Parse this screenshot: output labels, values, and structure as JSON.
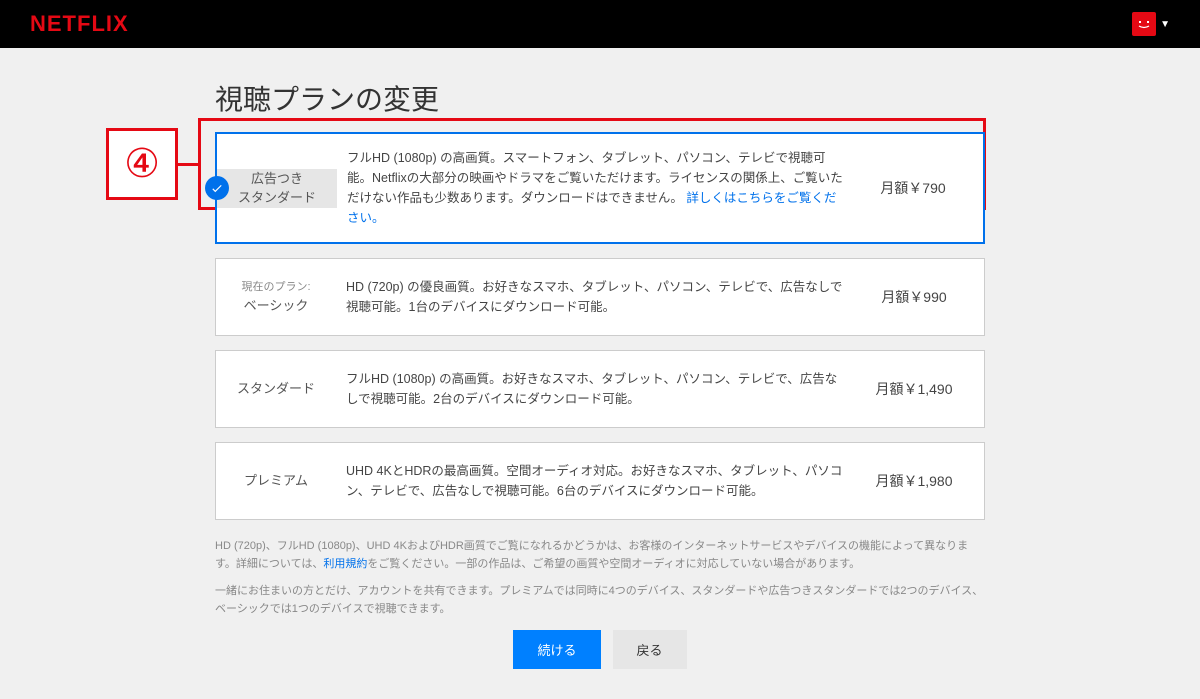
{
  "brand": "NETFLIX",
  "title": "視聴プランの変更",
  "annotation_num": "④",
  "plans": [
    {
      "name": "広告つき\nスタンダード",
      "tag": "",
      "desc_before_link": "フルHD (1080p) の高画質。スマートフォン、タブレット、パソコン、テレビで視聴可能。Netflixの大部分の映画やドラマをご覧いただけます。ライセンスの関係上、ご覧いただけない作品も少数あります。ダウンロードはできません。",
      "link": "詳しくはこちらをご覧ください。",
      "price": "月額￥790",
      "selected": true
    },
    {
      "name": "ベーシック",
      "tag": "現在のプラン:",
      "desc_before_link": "HD (720p) の優良画質。お好きなスマホ、タブレット、パソコン、テレビで、広告なしで視聴可能。1台のデバイスにダウンロード可能。",
      "link": "",
      "price": "月額￥990",
      "selected": false
    },
    {
      "name": "スタンダード",
      "tag": "",
      "desc_before_link": "フルHD (1080p) の高画質。お好きなスマホ、タブレット、パソコン、テレビで、広告なしで視聴可能。2台のデバイスにダウンロード可能。",
      "link": "",
      "price": "月額￥1,490",
      "selected": false
    },
    {
      "name": "プレミアム",
      "tag": "",
      "desc_before_link": "UHD 4KとHDRの最高画質。空間オーディオ対応。お好きなスマホ、タブレット、パソコン、テレビで、広告なしで視聴可能。6台のデバイスにダウンロード可能。",
      "link": "",
      "price": "月額￥1,980",
      "selected": false
    }
  ],
  "fineprint": {
    "p1_before": "HD (720p)、フルHD (1080p)、UHD 4KおよびHDR画質でご覧になれるかどうかは、お客様のインターネットサービスやデバイスの機能によって異なります。詳細については、",
    "p1_link": "利用規約",
    "p1_after": "をご覧ください。一部の作品は、ご希望の画質や空間オーディオに対応していない場合があります。",
    "p2": "一緒にお住まいの方とだけ、アカウントを共有できます。プレミアムでは同時に4つのデバイス、スタンダードや広告つきスタンダードでは2つのデバイス、ベーシックでは1つのデバイスで視聴できます。"
  },
  "buttons": {
    "continue": "続ける",
    "back": "戻る"
  }
}
